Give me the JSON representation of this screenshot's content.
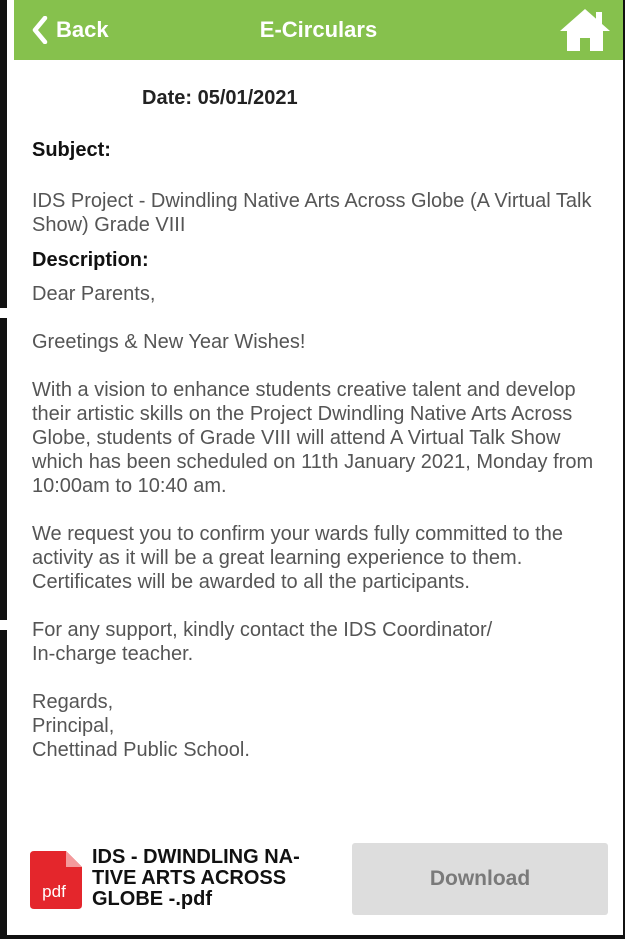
{
  "header": {
    "back_label": "Back",
    "title": "E-Circulars",
    "home_icon": "home-icon",
    "color": "#86c14d"
  },
  "circular": {
    "date": "Date:  05/01/2021",
    "subject_label": "Subject:",
    "subject": "IDS Project - Dwindling Native Arts Across Globe (A Virtual Talk Show) Grade VIII",
    "description_label": "Description:",
    "paragraphs": [
      "Dear Parents,",
      "Greetings & New Year Wishes!",
      "With a vision to enhance students creative talent and develop their artistic skills on the Project Dwindling Native Arts Across Globe, students of Grade VIII will attend A Virtual Talk Show which has been scheduled on 11th January 2021, Monday from 10:00am to 10:40 am.",
      "We request you to confirm your wards fully committed to the activity as it will be a great learning experience to them. Certificates will be awarded to all the participants.",
      "For any support, kindly contact the IDS Coordinator/\nIn-charge teacher.",
      "Regards,\nPrincipal,\nChettinad Public School."
    ]
  },
  "attachment": {
    "icon_label": "pdf",
    "file_name": "IDS - DWINDLING NA-\nTIVE ARTS ACROSS\nGLOBE -.pdf",
    "download_label": "Download"
  }
}
